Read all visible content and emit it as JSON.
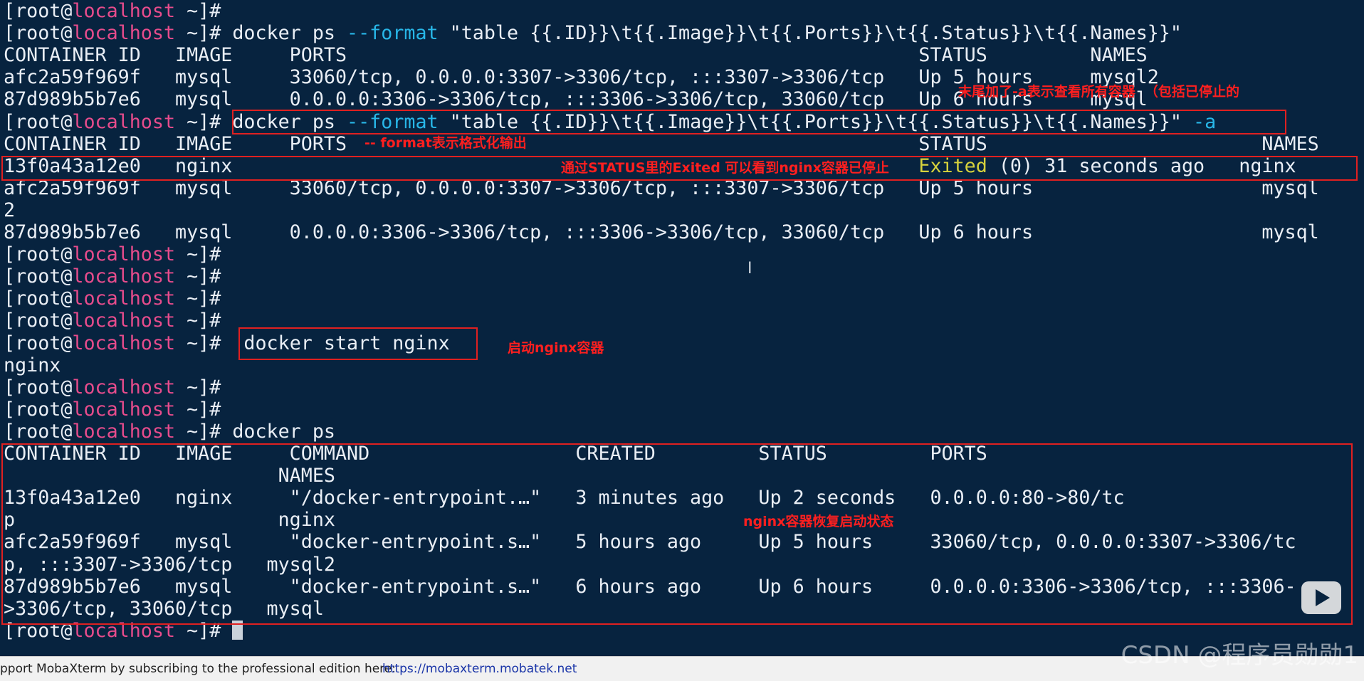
{
  "prompt": {
    "open": "[root@",
    "host": "localhost",
    "close": " ~]# "
  },
  "terminal": {
    "cmd1": {
      "pre": "docker ps ",
      "opt": "--format",
      "post": " \"table {{.ID}}\\t{{.Image}}\\t{{.Ports}}\\t{{.Status}}\\t{{.Names}}\""
    },
    "out1": [
      "CONTAINER ID   IMAGE     PORTS                                                  STATUS         NAMES",
      "afc2a59f969f   mysql     33060/tcp, 0.0.0.0:3307->3306/tcp, :::3307->3306/tcp   Up 5 hours     mysql2",
      "87d989b5b7e6   mysql     0.0.0.0:3306->3306/tcp, :::3306->3306/tcp, 33060/tcp   Up 6 hours     mysql"
    ],
    "cmd2": {
      "pre": "docker ps ",
      "opt": "--format",
      "post": " \"table {{.ID}}\\t{{.Image}}\\t{{.Ports}}\\t{{.Status}}\\t{{.Names}}\" ",
      "flag": "-a"
    },
    "out2_header": "CONTAINER ID   IMAGE     PORTS                                                  STATUS                        NAMES",
    "out2_row1": {
      "pre": "13f0a43a12e0   nginx                                                            ",
      "exited": "Exited",
      "post": " (0) 31 seconds ago   nginx"
    },
    "out2_rows": [
      "afc2a59f969f   mysql     33060/tcp, 0.0.0.0:3307->3306/tcp, :::3307->3306/tcp   Up 5 hours                    mysql",
      "2",
      "87d989b5b7e6   mysql     0.0.0.0:3306->3306/tcp, :::3306->3306/tcp, 33060/tcp   Up 6 hours                    mysql"
    ],
    "cmd3": "docker start nginx",
    "out3": "nginx",
    "cmd4": "docker ps",
    "out4": [
      "CONTAINER ID   IMAGE     COMMAND                  CREATED         STATUS         PORTS",
      "                        NAMES",
      "13f0a43a12e0   nginx     \"/docker-entrypoint.…\"   3 minutes ago   Up 2 seconds   0.0.0.0:80->80/tc",
      "p                       nginx",
      "afc2a59f969f   mysql     \"docker-entrypoint.s…\"   5 hours ago     Up 5 hours     33060/tcp, 0.0.0.0:3307->3306/tc",
      "p, :::3307->3306/tcp   mysql2",
      "87d989b5b7e6   mysql     \"docker-entrypoint.s…\"   6 hours ago     Up 6 hours     0.0.0.0:3306->3306/tcp, :::3306-",
      ">3306/tcp, 33060/tcp   mysql"
    ]
  },
  "annotations": {
    "a_flag": "末尾加了-a表示查看所有容器  （包括已停止的",
    "format": "-- format表示格式化输出",
    "exited": "通过STATUS里的Exited 可以看到nginx容器已停止",
    "start": "启动nginx容器",
    "restored": "nginx容器恢复启动状态"
  },
  "statusbar": {
    "message": "pport MobaXterm by subscribing to the professional edition here:",
    "link": "https://mobaxterm.mobatek.net"
  },
  "watermark": "CSDN @程序员勋勋1"
}
